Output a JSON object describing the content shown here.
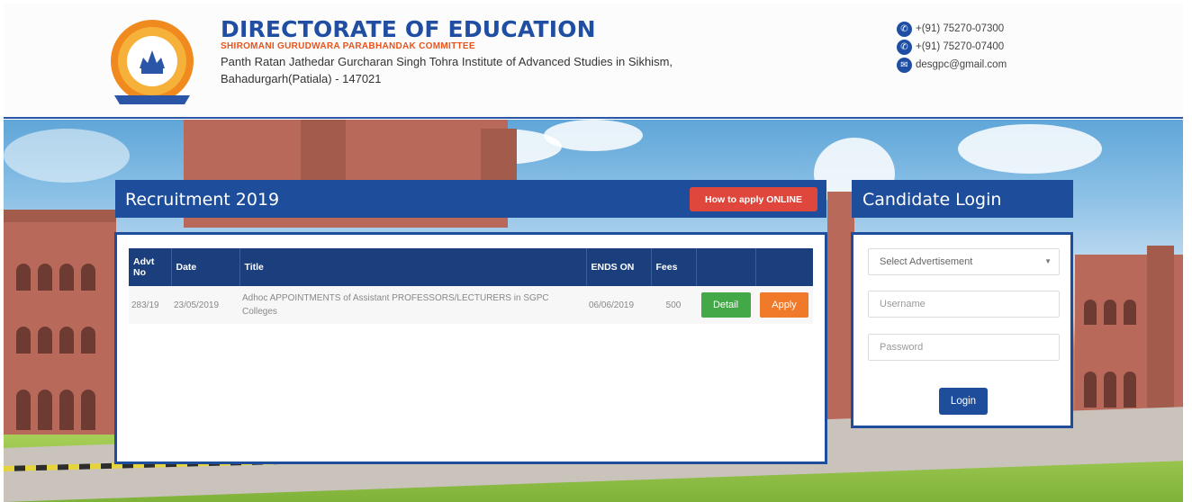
{
  "header": {
    "title": "DIRECTORATE OF EDUCATION",
    "subtitle": "SHIROMANI GURUDWARA PARABHANDAK COMMITTEE",
    "address_line1": "Panth Ratan Jathedar Gurcharan Singh Tohra Institute of Advanced Studies in Sikhism,",
    "address_line2": "Bahadurgarh(Patiala) - 147021"
  },
  "contacts": [
    {
      "icon": "phone-icon",
      "text": "+(91) 75270-07300"
    },
    {
      "icon": "phone-icon",
      "text": "+(91) 75270-07400"
    },
    {
      "icon": "email-icon",
      "text": "desgpc@gmail.com"
    }
  ],
  "recruitment": {
    "title": "Recruitment 2019",
    "how_to_apply": "How to apply ONLINE",
    "columns": [
      "Advt No",
      "Date",
      "Title",
      "ENDS ON",
      "Fees",
      "",
      ""
    ],
    "rows": [
      {
        "advt_no": "283/19",
        "date": "23/05/2019",
        "title": "Adhoc APPOINTMENTS of Assistant PROFESSORS/LECTURERS in SGPC Colleges",
        "ends_on": "06/06/2019",
        "fees": "500",
        "detail_label": "Detail",
        "apply_label": "Apply"
      }
    ]
  },
  "login": {
    "title": "Candidate Login",
    "select_placeholder": "Select Advertisement",
    "username_placeholder": "Username",
    "password_placeholder": "Password",
    "login_label": "Login"
  },
  "colors": {
    "brand_blue": "#1d4d9b",
    "accent_orange": "#e8541c",
    "how_btn_red": "#e0473c",
    "detail_green": "#43a847",
    "apply_orange": "#f07a2a"
  }
}
